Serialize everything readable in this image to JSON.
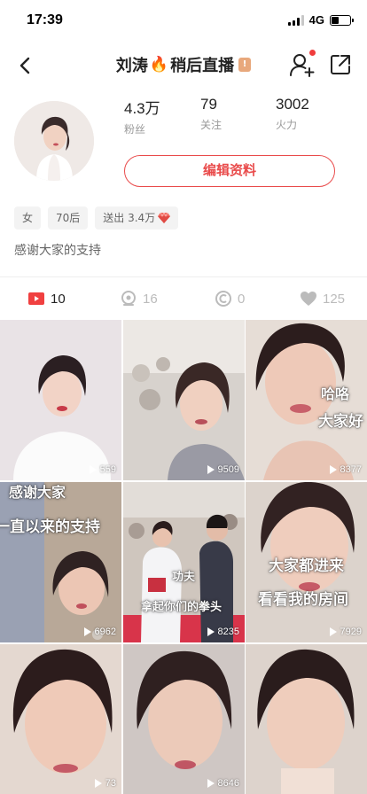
{
  "status": {
    "time": "17:39",
    "network": "4G"
  },
  "nav": {
    "title": "刘涛",
    "title_suffix": "稍后直播"
  },
  "stats": [
    {
      "value": "4.3万",
      "label": "粉丝"
    },
    {
      "value": "79",
      "label": "关注"
    },
    {
      "value": "3002",
      "label": "火力"
    }
  ],
  "edit_button": "编辑资料",
  "tags": [
    "女",
    "70后",
    "送出 3.4万"
  ],
  "bio": "感谢大家的支持",
  "tabs": [
    {
      "icon": "video-icon",
      "count": "10",
      "active": true
    },
    {
      "icon": "location-icon",
      "count": "16",
      "active": false
    },
    {
      "icon": "music-icon",
      "count": "0",
      "active": false
    },
    {
      "icon": "heart-icon",
      "count": "125",
      "active": false
    }
  ],
  "videos": [
    {
      "plays": "559",
      "caption": []
    },
    {
      "plays": "9509",
      "caption": []
    },
    {
      "plays": "8377",
      "caption": [
        "哈咯",
        "大家好"
      ]
    },
    {
      "plays": "6962",
      "caption": [
        "感谢大家",
        "一直以来的支持"
      ]
    },
    {
      "plays": "8235",
      "caption": [
        "功夫",
        "拿起你们的拳头"
      ]
    },
    {
      "plays": "7929",
      "caption": [
        "大家都进来",
        "看看我的房间"
      ]
    },
    {
      "plays": "73",
      "caption": []
    },
    {
      "plays": "8646",
      "caption": []
    },
    {
      "plays": "",
      "caption": []
    }
  ],
  "colors": {
    "accent": "#e94b4b",
    "tab_active_icon": "#f04040"
  }
}
